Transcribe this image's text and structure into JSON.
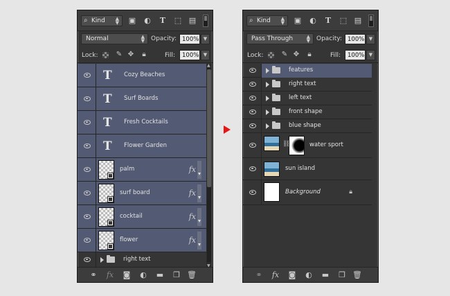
{
  "left_panel": {
    "filter_label": "Kind",
    "blend_mode": "Normal",
    "opacity_label": "Opacity:",
    "opacity_value": "100%",
    "lock_label": "Lock:",
    "fill_label": "Fill:",
    "fill_value": "100%",
    "layers": [
      {
        "name": "Cozy Beaches",
        "type": "text",
        "selected": true
      },
      {
        "name": "Surf Boards",
        "type": "text",
        "selected": true
      },
      {
        "name": "Fresh Cocktails",
        "type": "text",
        "selected": true
      },
      {
        "name": "Flower  Garden",
        "type": "text",
        "selected": true
      },
      {
        "name": "palm",
        "type": "shape",
        "fx": "fx",
        "selected": true
      },
      {
        "name": "surf board",
        "type": "shape",
        "fx": "fx",
        "selected": true
      },
      {
        "name": "cocktail",
        "type": "shape",
        "fx": "fx",
        "selected": true
      },
      {
        "name": "flower",
        "type": "shape",
        "fx": "fx",
        "selected": true
      },
      {
        "name": "right text",
        "type": "group",
        "selected": false
      }
    ]
  },
  "right_panel": {
    "filter_label": "Kind",
    "blend_mode": "Pass Through",
    "opacity_label": "Opacity:",
    "opacity_value": "100%",
    "lock_label": "Lock:",
    "fill_label": "Fill:",
    "fill_value": "100%",
    "groups": [
      {
        "name": "features",
        "selected": true
      },
      {
        "name": "right text",
        "selected": false
      },
      {
        "name": "left text",
        "selected": false
      },
      {
        "name": "front shape",
        "selected": false
      },
      {
        "name": "blue shape",
        "selected": false
      }
    ],
    "water_sport": "water sport",
    "sun_island": "sun island",
    "background": "Background"
  },
  "icons": {
    "search": "search-icon",
    "image_filter": "image-filter-icon",
    "adjustment_filter": "adjustment-filter-icon",
    "type_filter": "type-filter-icon",
    "shape_filter": "shape-filter-icon",
    "smart_object_filter": "smart-object-filter-icon",
    "visibility": "eye-icon",
    "link": "link-icon",
    "fx": "fx-icon",
    "mask": "mask-icon",
    "adjustment": "adjustment-icon",
    "group": "folder-icon",
    "new_layer": "new-layer-icon",
    "delete": "trash-icon",
    "lock": "lock-icon"
  },
  "colors": {
    "panel_bg": "#353535",
    "selected_row": "#535a73",
    "arrow": "#e81515",
    "page_bg": "#e6e6e6"
  }
}
